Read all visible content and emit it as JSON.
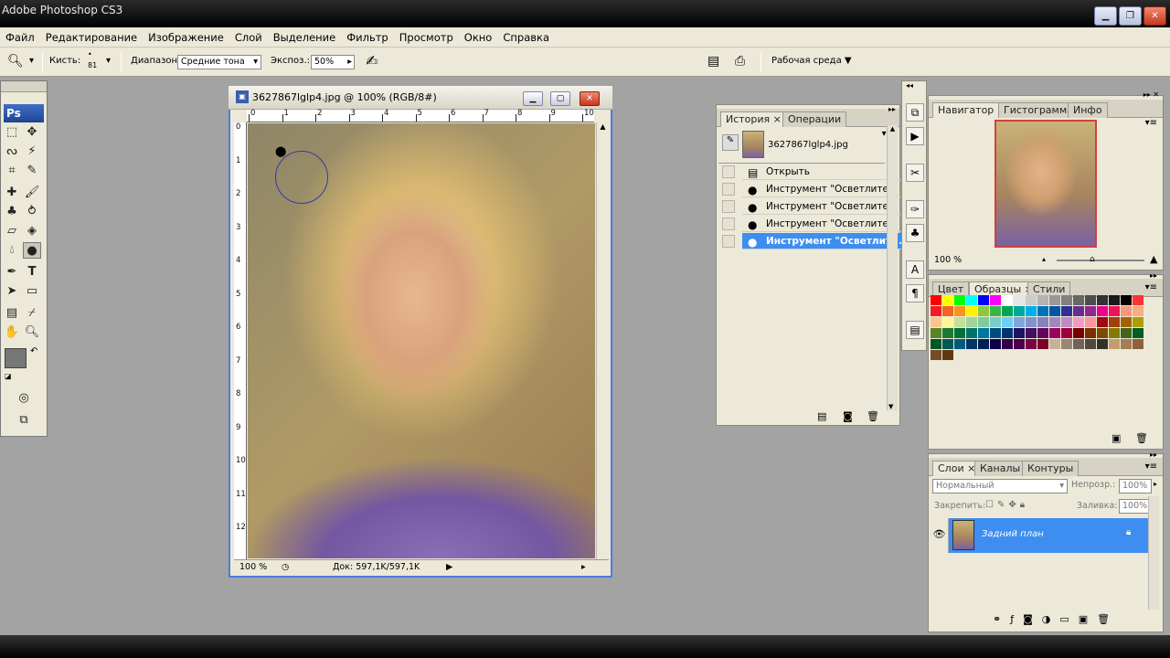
{
  "app": {
    "title": "Adobe Photoshop CS3"
  },
  "menu": [
    "Файл",
    "Редактирование",
    "Изображение",
    "Слой",
    "Выделение",
    "Фильтр",
    "Просмотр",
    "Окно",
    "Справка"
  ],
  "options": {
    "brush_label": "Кисть:",
    "brush_size": "81",
    "range_label": "Диапазон:",
    "range_value": "Средние тона",
    "exposure_label": "Экспоз.:",
    "exposure_value": "50%",
    "workspace_label": "Рабочая среда"
  },
  "toolbox": {
    "logo": "Ps"
  },
  "document": {
    "title": "3627867lglp4.jpg @ 100% (RGB/8#)",
    "ruler_h": [
      "0",
      "1",
      "2",
      "3",
      "4",
      "5",
      "6",
      "7",
      "8",
      "9",
      "10"
    ],
    "ruler_v": [
      "0",
      "1",
      "2",
      "3",
      "4",
      "5",
      "6",
      "7",
      "8",
      "9",
      "10",
      "11",
      "12"
    ],
    "zoom": "100 %",
    "doc_size": "Док: 597,1K/597,1K"
  },
  "history": {
    "tabs": [
      "История",
      "Операции"
    ],
    "snapshot": "3627867lglp4.jpg",
    "items": [
      "Открыть",
      "Инструмент \"Осветлите...",
      "Инструмент \"Осветлите...",
      "Инструмент \"Осветлите...",
      "Инструмент \"Осветлит..."
    ]
  },
  "navigator": {
    "tabs": [
      "Навигатор",
      "Гистограмма",
      "Инфо"
    ],
    "zoom": "100 %"
  },
  "swatch_panel": {
    "tabs": [
      "Цвет",
      "Образцы",
      "Стили"
    ]
  },
  "layers": {
    "tabs": [
      "Слои",
      "Каналы",
      "Контуры"
    ],
    "blend_mode": "Нормальный",
    "opacity_label": "Непрозр.:",
    "opacity_value": "100%",
    "lock_label": "Закрепить:",
    "fill_label": "Заливка:",
    "fill_value": "100%",
    "layer_name": "Задний план"
  }
}
